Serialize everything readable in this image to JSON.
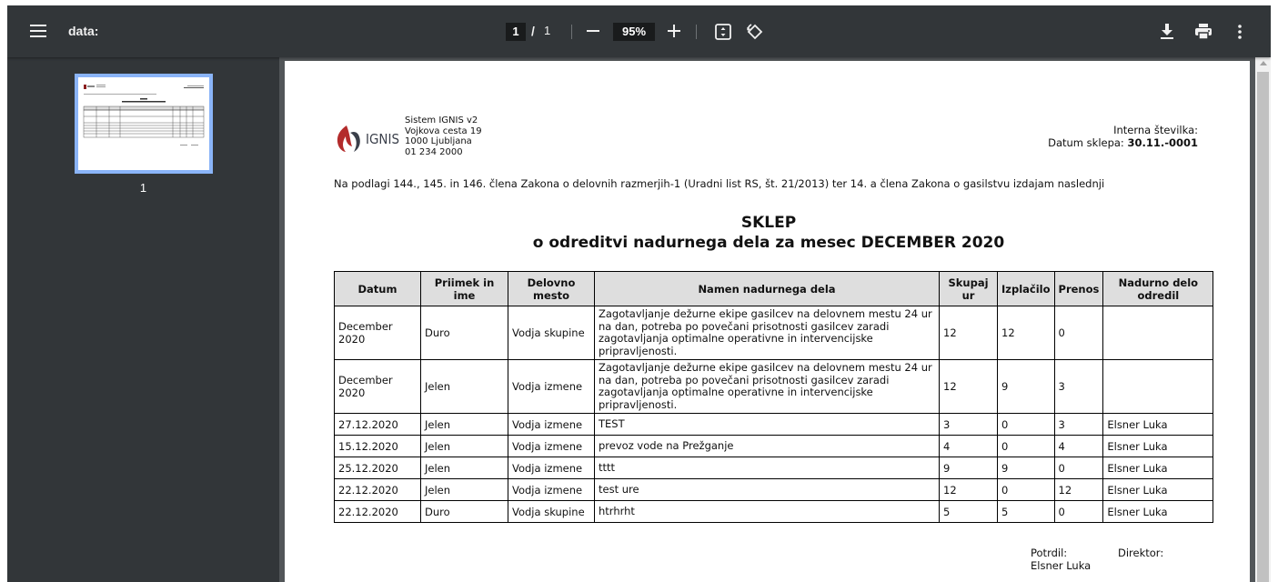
{
  "toolbar": {
    "title": "data:",
    "page_current": "1",
    "page_separator": "/",
    "page_total": "1",
    "zoom": "95%"
  },
  "sidebar": {
    "thumbnail_label": "1"
  },
  "document": {
    "brand": "IGNIS",
    "org_lines": [
      "Sistem IGNIS v2",
      "Vojkova cesta 19",
      "1000 Ljubljana",
      "01 234 2000"
    ],
    "intern_label": "Interna številka:",
    "datum_label": "Datum sklepa:",
    "datum_value": "30.11.-0001",
    "intro": "Na podlagi 144., 145. in 146. člena Zakona o delovnih razmerjih-1 (Uradni list RS, št. 21/2013) ter 14. a člena Zakona o gasilstvu izdajam naslednji",
    "title_line1": "SKLEP",
    "title_line2": "o odreditvi nadurnega dela za mesec DECEMBER 2020",
    "columns": [
      "Datum",
      "Priimek in ime",
      "Delovno mesto",
      "Namen nadurnega dela",
      "Skupaj ur",
      "Izplačilo",
      "Prenos",
      "Nadurno delo odredil"
    ],
    "rows": [
      [
        "December 2020",
        "Duro",
        "Vodja skupine",
        "Zagotavljanje dežurne ekipe gasilcev na delovnem mestu 24 ur na dan, potreba po povečani prisotnosti gasilcev zaradi zagotavljanja optimalne operativne in intervencijske pripravljenosti.",
        "12",
        "12",
        "0",
        ""
      ],
      [
        "December 2020",
        "Jelen",
        "Vodja izmene",
        "Zagotavljanje dežurne ekipe gasilcev na delovnem mestu 24 ur na dan, potreba po povečani prisotnosti gasilcev zaradi zagotavljanja optimalne operativne in intervencijske pripravljenosti.",
        "12",
        "9",
        "3",
        ""
      ],
      [
        "27.12.2020",
        "Jelen",
        "Vodja izmene",
        "TEST",
        "3",
        "0",
        "3",
        "Elsner Luka"
      ],
      [
        "15.12.2020",
        "Jelen",
        "Vodja izmene",
        "prevoz vode na Prežganje",
        "4",
        "0",
        "4",
        "Elsner Luka"
      ],
      [
        "25.12.2020",
        "Jelen",
        "Vodja izmene",
        "tttt",
        "9",
        "9",
        "0",
        "Elsner Luka"
      ],
      [
        "22.12.2020",
        "Jelen",
        "Vodja izmene",
        "test ure",
        "12",
        "0",
        "12",
        "Elsner Luka"
      ],
      [
        "22.12.2020",
        "Duro",
        "Vodja skupine",
        "htrhrht",
        "5",
        "5",
        "0",
        "Elsner Luka"
      ]
    ],
    "potrdil_label": "Potrdil:",
    "potrdil_name": "Elsner Luka",
    "direktor_label": "Direktor:"
  },
  "colors": {
    "toolbar_bg": "#323639",
    "viewer_bg": "#525659",
    "thumb_border": "#8ab4f8",
    "logo_dark": "#3a3f4a",
    "logo_red": "#b32b2b"
  }
}
